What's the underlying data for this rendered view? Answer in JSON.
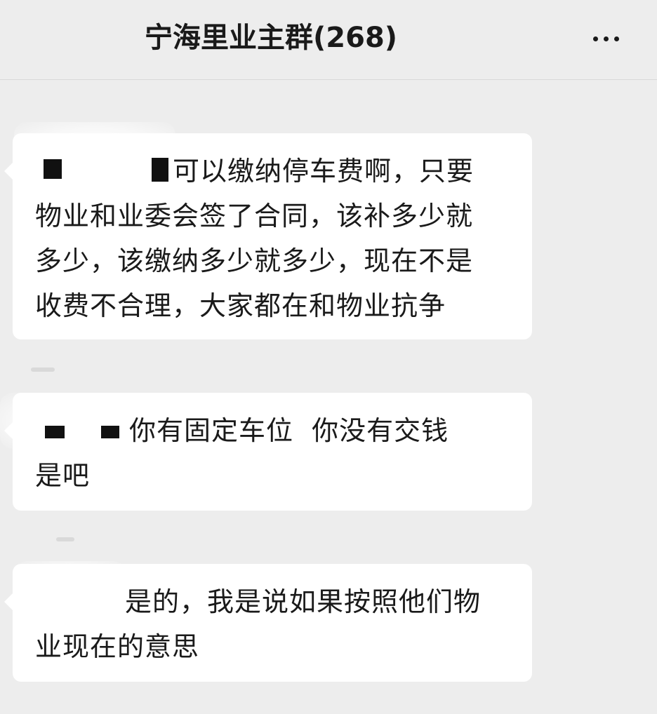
{
  "header": {
    "group_name": "宁海里业主群",
    "member_count": "(268)",
    "more_icon": "more-horizontal-icon"
  },
  "messages": [
    {
      "mention_redacted": true,
      "text_lines": [
        "可以缴纳停车费啊，只要",
        "物业和业委会签了合同，该补多少就",
        "多少，该缴纳多少就多少，现在不是",
        "收费不合理，大家都在和物业抗争"
      ]
    },
    {
      "mention_redacted": true,
      "text_lines": [
        "你有固定车位  你没有交钱",
        "是吧"
      ]
    },
    {
      "mention_redacted": true,
      "text_lines": [
        "是的，我是说如果按照他们物",
        "业现在的意思"
      ]
    }
  ],
  "colors": {
    "background": "#ededed",
    "bubble": "#ffffff",
    "text": "#1a1a1a"
  }
}
